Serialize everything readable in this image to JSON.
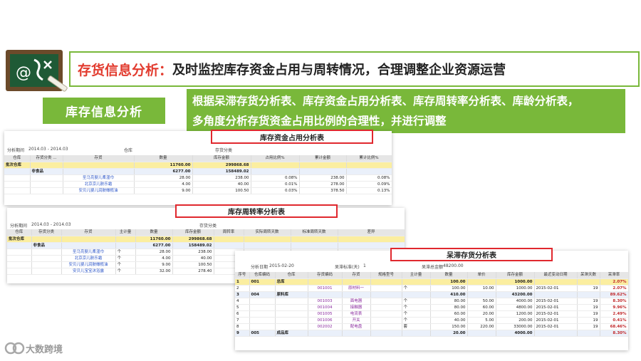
{
  "header": {
    "highlight": "存货信息分析：",
    "rest": "及时监控库存资金占用与周转情况，合理调整企业资源运营"
  },
  "section_label": "库存信息分析",
  "description": [
    "根据呆滞存货分析表、库存资金占用分析表、库存周转率分析表、库龄分析表，",
    "多角度分析存货资金占用比例的合理性，并进行调整"
  ],
  "colors": {
    "accent_green": "#79b83a",
    "highlight_red": "#e23b2e",
    "box_red": "#e0282e"
  },
  "report1": {
    "title": "库存资金占用分析表",
    "meta": {
      "period_label": "分析期间",
      "period": "2014.03 - 2014.03",
      "warehouse_label": "仓库",
      "category_label": "存货分类"
    },
    "columns": [
      "仓库",
      "存货分类 ...",
      "存货",
      "数量",
      "库存金额",
      "占用比例%",
      "累计金额",
      "累计比例%"
    ],
    "rows": [
      {
        "type": "tot",
        "cells": [
          "批次仓库",
          "",
          "",
          "11760.00",
          "299868.68",
          "",
          "",
          ""
        ]
      },
      {
        "type": "sub",
        "cells": [
          "",
          "非食品",
          "",
          "6277.00",
          "158489.02",
          "",
          "",
          ""
        ]
      },
      {
        "type": "item",
        "cells": [
          "",
          "",
          "圣马克婴儿柔湿巾",
          "28.00",
          "238.00",
          "0.08%",
          "238.00",
          "0.08%"
        ]
      },
      {
        "type": "item",
        "cells": [
          "",
          "",
          "北京京儿肤乐霜",
          "4.00",
          "40.00",
          "0.01%",
          "278.00",
          "0.09%"
        ]
      },
      {
        "type": "item",
        "cells": [
          "",
          "",
          "安贝儿婴儿润肤橄榄油",
          "9.00",
          "100.50",
          "0.03%",
          "378.50",
          "0.13%"
        ]
      }
    ]
  },
  "report2": {
    "title": "库存周转率分析表",
    "meta": {
      "period_label": "分析期间",
      "period": "2014.03 - 2014.03",
      "category_label": "存货分类"
    },
    "columns": [
      "仓库",
      "存货分类",
      "存货",
      "主计量",
      "数量",
      "库存金额",
      "周转率",
      "实际周转天数",
      "标准周转天数",
      "差异"
    ],
    "rows": [
      {
        "type": "tot",
        "cells": [
          "批次仓库",
          "",
          "",
          "",
          "11760.00",
          "299868.68",
          "",
          "",
          "",
          ""
        ]
      },
      {
        "type": "sub",
        "cells": [
          "",
          "非食品",
          "",
          "",
          "6277.00",
          "158489.02",
          "",
          "",
          "",
          ""
        ]
      },
      {
        "type": "item",
        "cells": [
          "",
          "",
          "圣马克婴儿柔湿巾",
          "个",
          "28.00",
          "238.00",
          "",
          "",
          "",
          ""
        ]
      },
      {
        "type": "item",
        "cells": [
          "",
          "",
          "北京京儿肤乐霜",
          "个",
          "4.00",
          "40.00",
          "",
          "",
          "",
          ""
        ]
      },
      {
        "type": "item",
        "cells": [
          "",
          "",
          "安贝儿婴儿润肤橄榄油",
          "个",
          "9.00",
          "100.50",
          "",
          "",
          "",
          ""
        ]
      },
      {
        "type": "item",
        "cells": [
          "",
          "",
          "安贝儿宝宝沐浴露",
          "个",
          "32.00",
          "278.40",
          "",
          "",
          "",
          ""
        ]
      }
    ]
  },
  "report3": {
    "title": "呆滞存货分析表",
    "meta": {
      "date_label": "分析日期",
      "date": "2015-02-20",
      "std_label": "呆滞标准(天)",
      "std": "1",
      "total_label": "呆滞总金额",
      "total": "48200.00"
    },
    "columns": [
      "序号",
      "仓库编码",
      "仓库",
      "存货编码",
      "存货",
      "规格型号",
      "主计量",
      "数量",
      "单价",
      "库存金额",
      "最近变动日期",
      "呆滞天数",
      "呆滞率"
    ],
    "rows": [
      {
        "type": "tot",
        "cells": [
          "1",
          "001",
          "总库",
          "",
          "",
          "",
          "",
          "100.00",
          "",
          "1000.00",
          "",
          "",
          "2.07%"
        ]
      },
      {
        "type": "item",
        "cells": [
          "2",
          "",
          "",
          "001001",
          "原材料一",
          "",
          "个",
          "100.00",
          "10.00",
          "1000.00",
          "2015-02-01",
          "19",
          "2.07%"
        ]
      },
      {
        "type": "sub",
        "cells": [
          "3",
          "004",
          "原料库",
          "",
          "",
          "",
          "",
          "410.00",
          "",
          "43200.00",
          "",
          "",
          "89.62%"
        ]
      },
      {
        "type": "item",
        "cells": [
          "4",
          "",
          "",
          "001003",
          "面电器",
          "",
          "个",
          "80.00",
          "50.00",
          "4000.00",
          "2015-02-01",
          "19",
          "8.30%"
        ]
      },
      {
        "type": "item",
        "cells": [
          "5",
          "",
          "",
          "001004",
          "接触器",
          "",
          "个",
          "80.00",
          "60.00",
          "4800.00",
          "2015-02-01",
          "19",
          "9.96%"
        ]
      },
      {
        "type": "item",
        "cells": [
          "6",
          "",
          "",
          "001005",
          "电流表",
          "",
          "个",
          "60.00",
          "20.00",
          "1200.00",
          "2015-02-01",
          "19",
          "2.49%"
        ]
      },
      {
        "type": "item",
        "cells": [
          "7",
          "",
          "",
          "001006",
          "开关",
          "",
          "个",
          "40.00",
          "5.00",
          "200.00",
          "2015-02-01",
          "19",
          "0.41%"
        ]
      },
      {
        "type": "item",
        "cells": [
          "8",
          "",
          "",
          "002002",
          "配电盘",
          "",
          "套",
          "150.00",
          "220.00",
          "33000.00",
          "2015-02-01",
          "19",
          "68.46%"
        ]
      },
      {
        "type": "sub",
        "cells": [
          "9",
          "005",
          "成品库",
          "",
          "",
          "",
          "",
          "20.00",
          "",
          "4000.00",
          "",
          "",
          "8.30%"
        ]
      }
    ]
  },
  "watermark": "大数跨境"
}
